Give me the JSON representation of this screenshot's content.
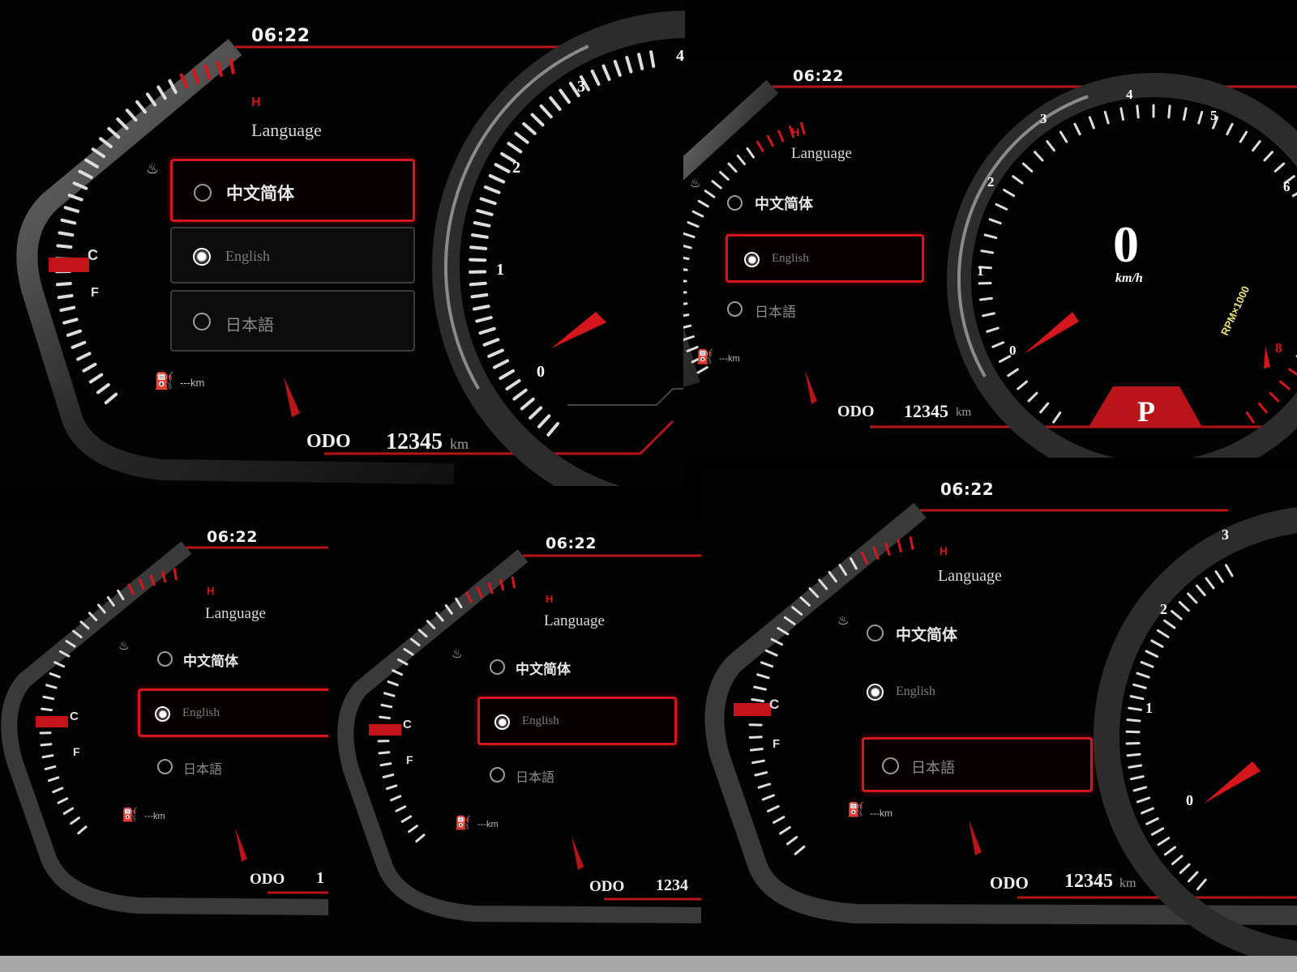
{
  "colors": {
    "accent_red": "#d5161c",
    "background": "#030303",
    "text_primary": "#f2f2f2",
    "text_dim": "#7d7d7d"
  },
  "icons": [
    "coolant-temp-icon",
    "fuel-pump-icon",
    "radio-button-icon",
    "gear-indicator"
  ],
  "cluster": {
    "time": "06:22",
    "language_title": "Language",
    "options": [
      "中文简体",
      "English",
      "日本語"
    ],
    "temp_high": "H",
    "temp_cold": "C",
    "fuel_full": "F",
    "fuel_range": "---km",
    "odo_label": "ODO",
    "odo_value": "12345",
    "odo_unit": "km",
    "speed_value": "0",
    "speed_unit": "km/h",
    "gear": "P",
    "rpm_label": "RPM×1000",
    "speed_ticks": [
      "0",
      "1",
      "2",
      "3",
      "4",
      "5",
      "6",
      "8"
    ]
  },
  "panels": [
    {
      "id": "a",
      "selected_option": 0,
      "radio_on": 1
    },
    {
      "id": "b",
      "selected_option": 1,
      "radio_on": 1
    },
    {
      "id": "c",
      "selected_option": 1,
      "radio_on": 1
    },
    {
      "id": "d",
      "selected_option": 1,
      "radio_on": 1
    },
    {
      "id": "e",
      "selected_option": 2,
      "radio_on": 1
    }
  ],
  "odo_partial": {
    "c": "1",
    "d": "1234"
  }
}
